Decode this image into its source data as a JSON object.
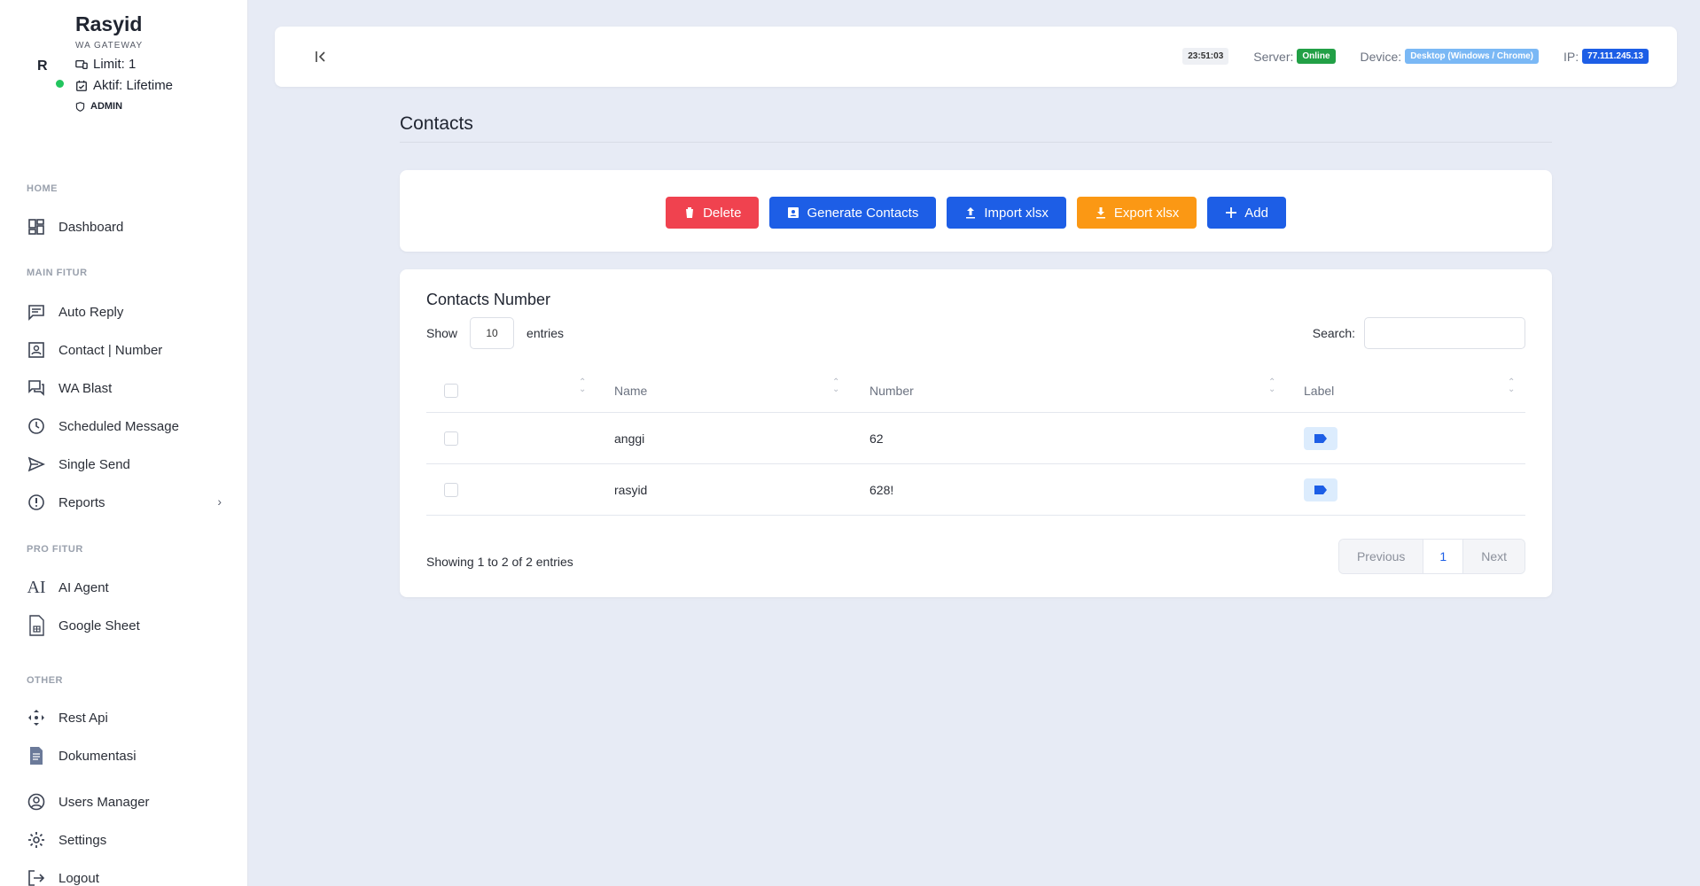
{
  "profile": {
    "avatar_letter": "R",
    "name": "Rasyid",
    "subtitle": "WA GATEWAY",
    "limit": "Limit: 1",
    "active": "Aktif: Lifetime",
    "role": "ADMIN"
  },
  "sidebar": {
    "sections": [
      "HOME",
      "MAIN FITUR",
      "PRO FITUR",
      "OTHER"
    ],
    "items": [
      {
        "label": "Dashboard",
        "icon": "dashboard-icon"
      },
      {
        "label": "Auto Reply",
        "icon": "message-icon"
      },
      {
        "label": "Contact | Number",
        "icon": "contact-icon"
      },
      {
        "label": "WA Blast",
        "icon": "chat-icon"
      },
      {
        "label": "Scheduled Message",
        "icon": "clock-icon"
      },
      {
        "label": "Single Send",
        "icon": "send-icon"
      },
      {
        "label": "Reports",
        "icon": "alert-circle-icon"
      },
      {
        "label": "AI Agent",
        "icon": "ai-icon"
      },
      {
        "label": "Google Sheet",
        "icon": "sheet-icon"
      },
      {
        "label": "Rest Api",
        "icon": "api-icon"
      },
      {
        "label": "Dokumentasi",
        "icon": "document-icon"
      },
      {
        "label": "Users Manager",
        "icon": "user-icon"
      },
      {
        "label": "Settings",
        "icon": "gear-icon"
      },
      {
        "label": "Logout",
        "icon": "logout-icon"
      }
    ]
  },
  "topbar": {
    "collapse_icon": "collapse-left-icon",
    "time": "23:51:03",
    "server_label": "Server:",
    "server_status": "Online",
    "device_label": "Device:",
    "device_value": "Desktop (Windows / Chrome)",
    "ip_label": "IP:",
    "ip_value": "77.111.245.13"
  },
  "page": {
    "title": "Contacts"
  },
  "actions": {
    "delete": "Delete",
    "generate": "Generate Contacts",
    "import": "Import xlsx",
    "export": "Export xlsx",
    "add": "Add"
  },
  "table": {
    "title": "Contacts Number",
    "show_label": "Show",
    "entries_value": "10",
    "entries_label": "entries",
    "search_label": "Search:",
    "search_value": "",
    "columns": [
      "Name",
      "Number",
      "Label"
    ],
    "rows": [
      {
        "name": "anggi",
        "number": "62"
      },
      {
        "name": "rasyid",
        "number": "628!"
      }
    ],
    "showing": "Showing 1 to 2 of 2 entries",
    "pagination": {
      "previous": "Previous",
      "current": "1",
      "next": "Next"
    }
  },
  "colors": {
    "red": "#f0424f",
    "blue": "#1d5ee6",
    "orange": "#fb9814",
    "green": "#22a046",
    "background": "#e7ebf5"
  }
}
